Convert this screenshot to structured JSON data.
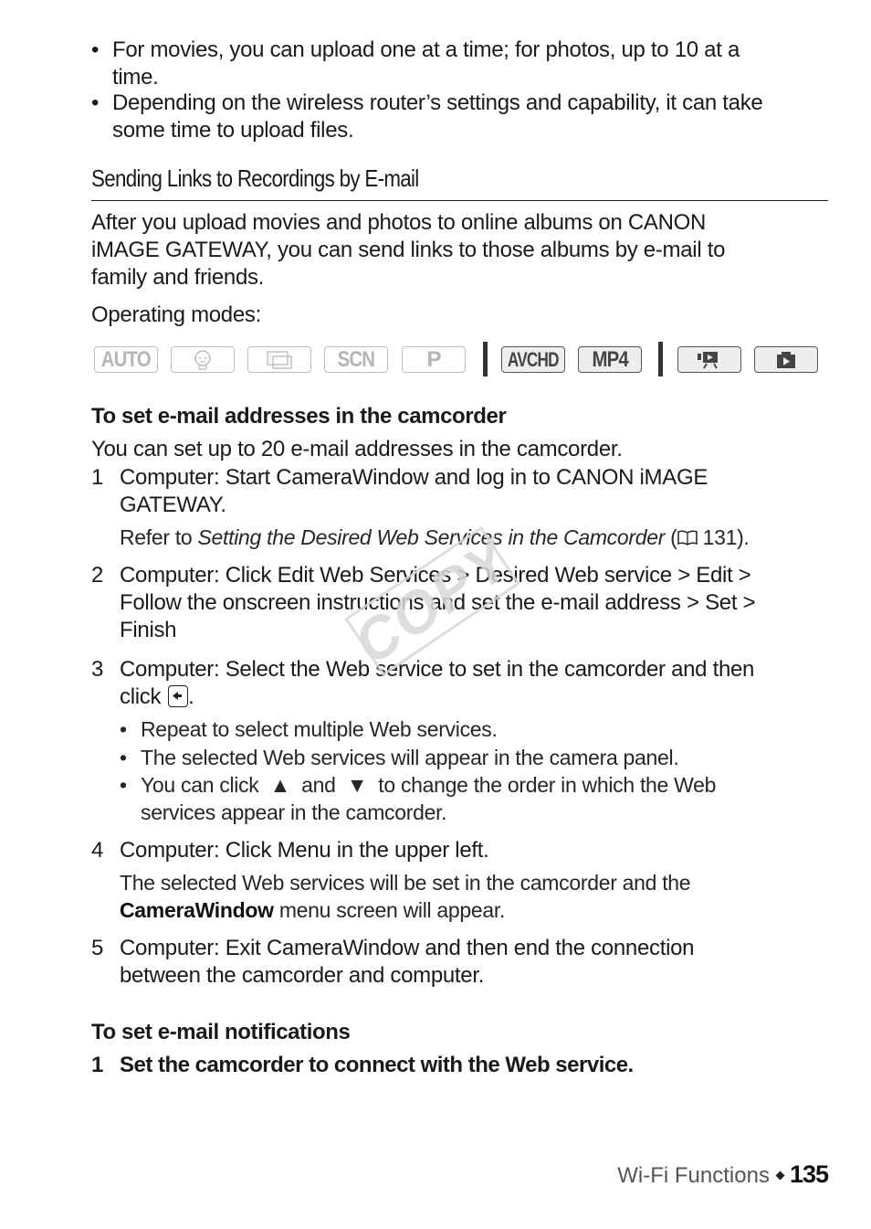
{
  "top_bullets": [
    {
      "line1": "For movies, you can upload one at a time; for photos, up to 10 at a",
      "line2": "time."
    },
    {
      "line1": "Depending on the wireless router’s settings and capability, it can take",
      "line2": "some time to upload files."
    }
  ],
  "section": {
    "title": "Sending Links to Recordings by E-mail",
    "intro": [
      "After you upload movies and photos to online albums on CANON",
      "iMAGE GATEWAY, you can send links to those albums by e-mail to",
      "family and friends."
    ],
    "operating_modes_label": "Operating modes:",
    "modes": [
      {
        "label": "AUTO",
        "icon": "auto-mode-icon",
        "active": false
      },
      {
        "label": "",
        "icon": "baby-mode-icon",
        "active": false
      },
      {
        "label": "",
        "icon": "cinema-mode-icon",
        "active": false
      },
      {
        "label": "SCN",
        "icon": "scene-mode-icon",
        "active": false
      },
      {
        "label": "P",
        "icon": "program-mode-icon",
        "active": false
      },
      {
        "label": "AVCHD",
        "icon": "avchd-format-icon",
        "active": true
      },
      {
        "label": "MP4",
        "icon": "mp4-format-icon",
        "active": true
      },
      {
        "label": "",
        "icon": "movie-playback-icon",
        "active": true
      },
      {
        "label": "",
        "icon": "photo-playback-icon",
        "active": true
      }
    ]
  },
  "email_addresses": {
    "heading": "To set e-mail addresses in the camcorder",
    "intro": "You can set up to 20 e-mail addresses in the camcorder.",
    "steps": [
      {
        "num": "1",
        "lines": [
          "Computer: Start CameraWindow and log in to CANON iMAGE",
          "GATEWAY."
        ],
        "ref_prefix": "Refer to ",
        "ref_italic": "Setting the Desired Web Services in the Camcorder",
        "ref_open": " (",
        "ref_page": " 131)."
      },
      {
        "num": "2",
        "lines": [
          "Computer: Click Edit Web Services > Desired Web service > Edit >",
          "Follow the onscreen instructions and set the e-mail address > Set >",
          "Finish"
        ]
      },
      {
        "num": "3",
        "lines": [
          "Computer: Select the Web service to set in the camcorder and then",
          "click"
        ],
        "line2_suffix": ".",
        "bullets": [
          "Repeat to select multiple Web services.",
          "The selected Web services will appear in the camera panel."
        ],
        "order_bullet": {
          "prefix": "You can click",
          "and": "and",
          "suffix": "to change the order in which the Web",
          "line2": "services appear in the camcorder.",
          "up": "▲",
          "down": "▼"
        }
      },
      {
        "num": "4",
        "lines": [
          "Computer: Click Menu in the upper left."
        ],
        "note_line1": "The selected Web services will be set in the camcorder and the",
        "note_bold": "CameraWindow",
        "note_rest": " menu screen will appear."
      },
      {
        "num": "5",
        "lines": [
          "Computer: Exit CameraWindow and then end the connection",
          "between the camcorder and computer."
        ]
      }
    ]
  },
  "notifications": {
    "heading": "To set e-mail notifications",
    "steps": [
      {
        "num": "1",
        "text": "Set the camcorder to connect with the Web service."
      }
    ]
  },
  "watermark": "COPY",
  "footer": {
    "section": "Wi-Fi Functions",
    "page": "135"
  }
}
